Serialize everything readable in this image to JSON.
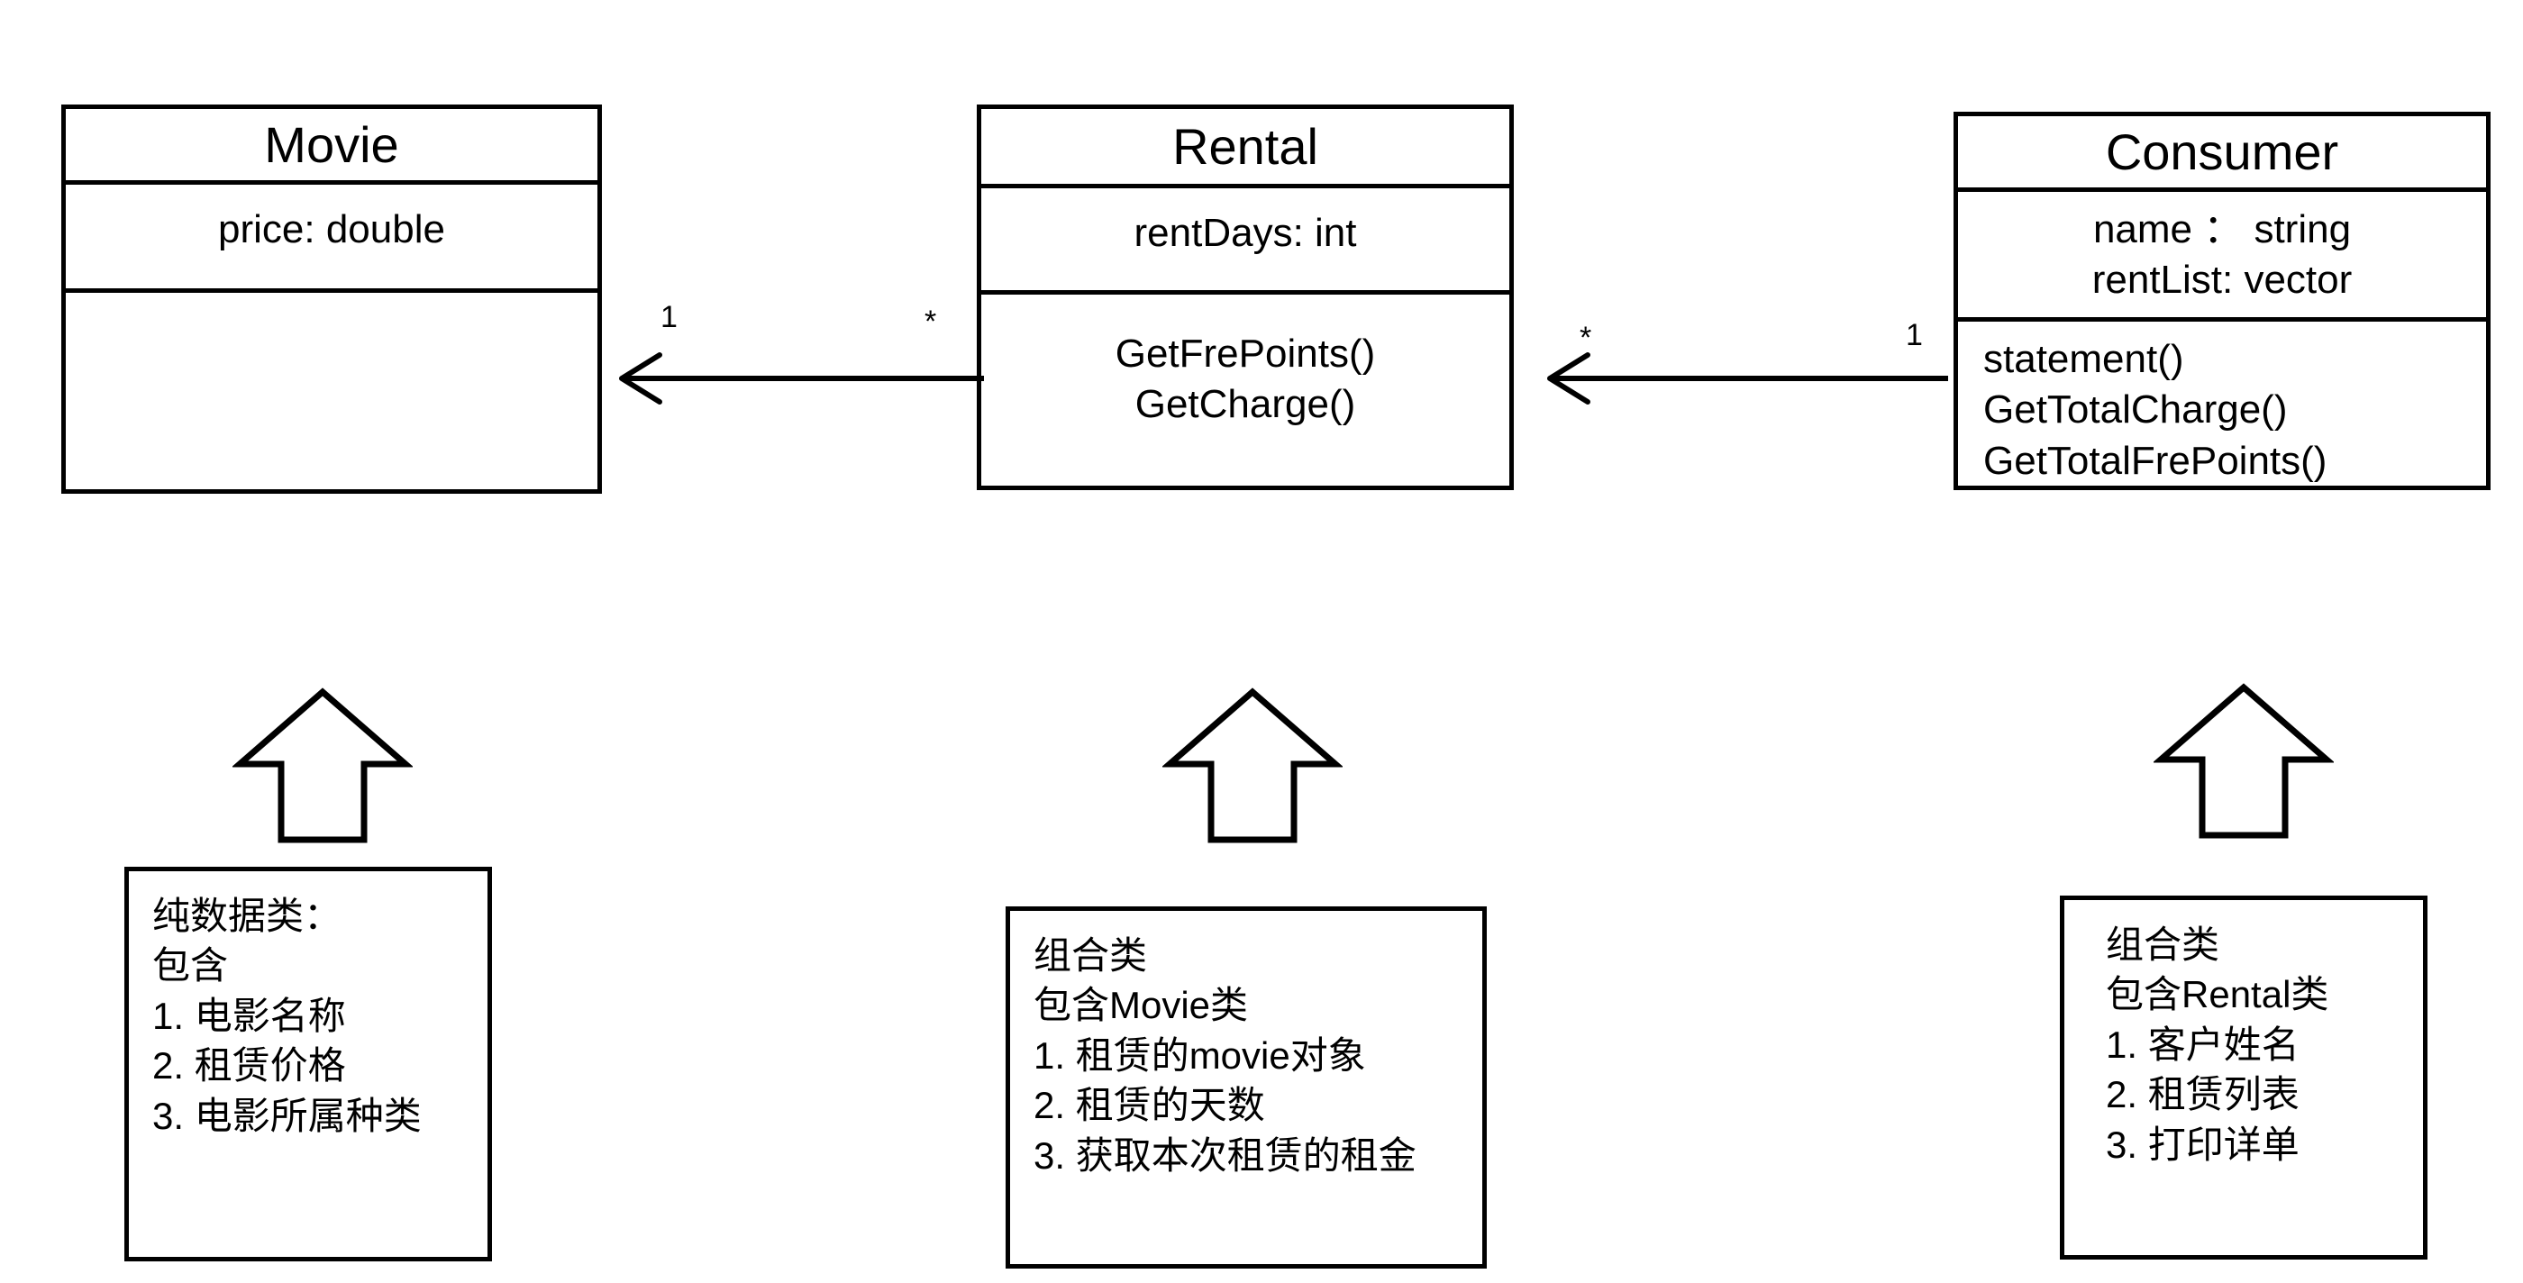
{
  "diagram": {
    "type": "uml-class-diagram",
    "title": "Movie Rental UML Class Diagram",
    "background_color": "#ffffff",
    "line_color": "#000000"
  },
  "classes": [
    {
      "id": "movie",
      "name": "Movie",
      "attributes": [
        "price: double"
      ],
      "methods": []
    },
    {
      "id": "rental",
      "name": "Rental",
      "attributes": [
        "rentDays: int"
      ],
      "methods": [
        "GetFrePoints()",
        "GetCharge()"
      ]
    },
    {
      "id": "consumer",
      "name": "Consumer",
      "attributes": [
        "name ： string",
        "rentList:  vector"
      ],
      "methods": [
        "statement()",
        "GetTotalCharge()",
        "GetTotalFrePoints()"
      ]
    }
  ],
  "associations": [
    {
      "id": "rental-to-movie",
      "from": "Rental",
      "to": "Movie",
      "source_multiplicity": "*",
      "target_multiplicity": "1"
    },
    {
      "id": "consumer-to-rental",
      "from": "Consumer",
      "to": "Rental",
      "source_multiplicity": "1",
      "target_multiplicity": "*"
    }
  ],
  "notes": [
    {
      "id": "movie-note",
      "attached_to": "Movie",
      "lines": [
        "纯数据类：",
        "包含",
        "1. 电影名称",
        "2. 租赁价格",
        "3. 电影所属种类"
      ]
    },
    {
      "id": "rental-note",
      "attached_to": "Rental",
      "lines": [
        "组合类",
        "包含Movie类",
        "1. 租赁的movie对象",
        "2. 租赁的天数",
        "3. 获取本次租赁的租金"
      ]
    },
    {
      "id": "consumer-note",
      "attached_to": "Consumer",
      "lines": [
        "组合类",
        "包含Rental类",
        "1. 客户姓名",
        "2. 租赁列表",
        "3. 打印详单"
      ]
    }
  ]
}
